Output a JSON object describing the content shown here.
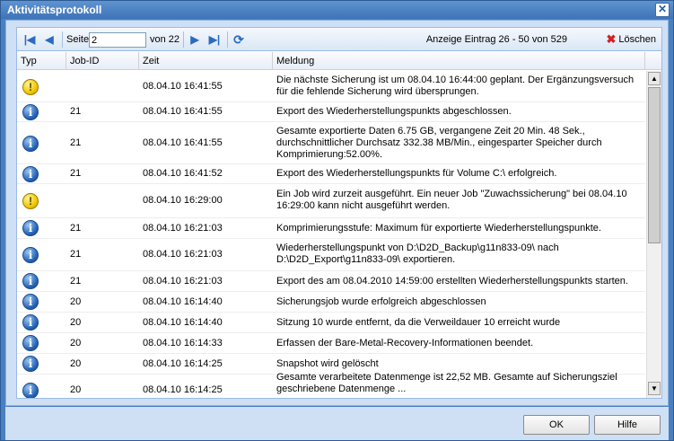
{
  "window": {
    "title": "Aktivitätsprotokoll",
    "close_glyph": "✕"
  },
  "toolbar": {
    "page_label": "Seite",
    "page_value": "2",
    "page_of": "von 22",
    "display_info": "Anzeige Eintrag 26 - 50 von 529",
    "clear_label": "Löschen",
    "icons": [
      "first-page-icon",
      "previous-page-icon",
      "next-page-icon",
      "last-page-icon",
      "refresh-icon",
      "delete-icon"
    ]
  },
  "columns": {
    "type": "Typ",
    "job": "Job-ID",
    "time": "Zeit",
    "message": "Meldung"
  },
  "rows": [
    {
      "type": "warning",
      "job": "",
      "time": "08.04.10 16:41:55",
      "message": "Die nächste Sicherung ist um 08.04.10 16:44:00 geplant. Der Ergänzungsversuch für die fehlende Sicherung wird übersprungen."
    },
    {
      "type": "info",
      "job": "21",
      "time": "08.04.10 16:41:55",
      "message": "Export des Wiederherstellungspunkts abgeschlossen."
    },
    {
      "type": "info",
      "job": "21",
      "time": "08.04.10 16:41:55",
      "message": "Gesamte exportierte Daten 6.75 GB, vergangene Zeit 20 Min. 48 Sek., durchschnittlicher Durchsatz 332.38 MB/Min., eingesparter Speicher durch Komprimierung:52.00%."
    },
    {
      "type": "info",
      "job": "21",
      "time": "08.04.10 16:41:52",
      "message": "Export des Wiederherstellungspunkts für Volume C:\\ erfolgreich."
    },
    {
      "type": "warning",
      "job": "",
      "time": "08.04.10 16:29:00",
      "message": "Ein Job wird zurzeit ausgeführt. Ein neuer Job \"Zuwachssicherung\" bei 08.04.10 16:29:00 kann nicht ausgeführt werden."
    },
    {
      "type": "info",
      "job": "21",
      "time": "08.04.10 16:21:03",
      "message": "Komprimierungsstufe: Maximum für exportierte Wiederherstellungspunkte."
    },
    {
      "type": "info",
      "job": "21",
      "time": "08.04.10 16:21:03",
      "message": "Wiederherstellungspunkt von D:\\D2D_Backup\\g11n833-09\\ nach D:\\D2D_Export\\g11n833-09\\ exportieren."
    },
    {
      "type": "info",
      "job": "21",
      "time": "08.04.10 16:21:03",
      "message": "Export des am 08.04.2010 14:59:00 erstellten Wiederherstellungspunkts starten."
    },
    {
      "type": "info",
      "job": "20",
      "time": "08.04.10 16:14:40",
      "message": "Sicherungsjob wurde erfolgreich abgeschlossen"
    },
    {
      "type": "info",
      "job": "20",
      "time": "08.04.10 16:14:40",
      "message": "Sitzung 10 wurde entfernt, da die Verweildauer 10 erreicht wurde"
    },
    {
      "type": "info",
      "job": "20",
      "time": "08.04.10 16:14:33",
      "message": "Erfassen der Bare-Metal-Recovery-Informationen beendet."
    },
    {
      "type": "info",
      "job": "20",
      "time": "08.04.10 16:14:25",
      "message": "Snapshot wird gelöscht"
    },
    {
      "type": "info",
      "job": "20",
      "time": "08.04.10 16:14:25",
      "message": "Gesamte verarbeitete Datenmenge ist 22,52 MB. Gesamte auf Sicherungsziel geschriebene Datenmenge ..."
    }
  ],
  "footer": {
    "ok_label": "OK",
    "help_label": "Hilfe"
  }
}
